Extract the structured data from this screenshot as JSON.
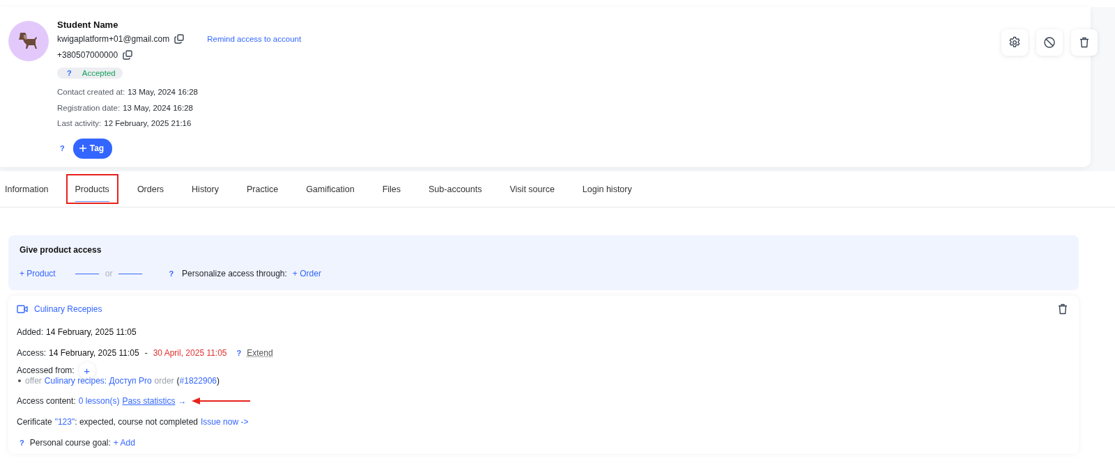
{
  "profile": {
    "name": "Student Name",
    "email": "kwigaplatform+01@gmail.com",
    "remind_link": "Remind access to account",
    "phone": "+380507000000",
    "status": {
      "help": "?",
      "label": "Accepted"
    },
    "details": [
      {
        "label": "Contact created at:",
        "value": "13 May, 2024 16:28"
      },
      {
        "label": "Registration date:",
        "value": "13 May, 2024 16:28"
      },
      {
        "label": "Last activity:",
        "value": "12 February, 2025 21:16"
      }
    ],
    "tag_help": "?",
    "tag_button": "Tag"
  },
  "actions": [
    {
      "kind": "settings"
    },
    {
      "kind": "block"
    },
    {
      "kind": "delete"
    }
  ],
  "tabs": [
    {
      "label": "Information",
      "selected": false,
      "highlighted": false
    },
    {
      "label": "Products",
      "selected": true,
      "highlighted": true
    },
    {
      "label": "Orders",
      "selected": false,
      "highlighted": false
    },
    {
      "label": "History",
      "selected": false,
      "highlighted": false
    },
    {
      "label": "Practice",
      "selected": false,
      "highlighted": false
    },
    {
      "label": "Gamification",
      "selected": false,
      "highlighted": false
    },
    {
      "label": "Files",
      "selected": false,
      "highlighted": false
    },
    {
      "label": "Sub-accounts",
      "selected": false,
      "highlighted": false
    },
    {
      "label": "Visit source",
      "selected": false,
      "highlighted": false
    },
    {
      "label": "Login history",
      "selected": false,
      "highlighted": false
    }
  ],
  "give_access": {
    "title": "Give product access",
    "product_link": "+ Product",
    "or": "or",
    "help": "?",
    "personalize_label": "Personalize access through:",
    "order_link": "+ Order"
  },
  "product": {
    "title": "Culinary Recepies",
    "added": {
      "label": "Added:",
      "value": "14 February, 2025 11:05"
    },
    "access": {
      "label": "Access:",
      "start": "14 February, 2025 11:05",
      "separator": "-",
      "end": "30 April, 2025 11:05",
      "help": "?",
      "extend": "Extend"
    },
    "accessed_from": {
      "label": "Accessed from:",
      "add": "+",
      "sources": [
        {
          "prefix": "offer",
          "name": "Culinary recipes: Доступ Pro",
          "type": "order",
          "open": "(",
          "number": "#1822906",
          "close": ")"
        }
      ]
    },
    "access_content": {
      "label": "Access content:",
      "lessons": "0 lesson(s)",
      "stats": "Pass statistics",
      "arrow": "→",
      "annotated": true
    },
    "certificate": {
      "label": "Cerificate",
      "name": "\"123\"",
      "status": ": expected, course not completed",
      "issue": "Issue now ->"
    },
    "goal": {
      "help": "?",
      "label": "Personal course goal:",
      "add": "+ Add"
    }
  }
}
